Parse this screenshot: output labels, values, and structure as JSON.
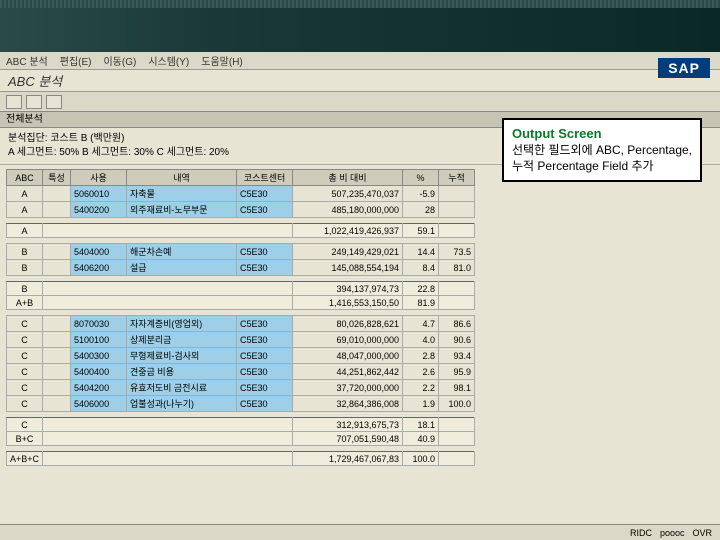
{
  "menu": {
    "items": [
      "ABC 분석",
      "편집(E)",
      "이동(G)",
      "시스템(Y)",
      "도움말(H)"
    ]
  },
  "title": "ABC 분석",
  "sub": "전체분석",
  "logo": "SAP",
  "params": {
    "line1": "분석집단: 코스트 B (백만원)",
    "line2": "A 세그먼트: 50%    B 세그먼트: 30%    C 세그먼트: 20%"
  },
  "headers": [
    "ABC",
    "특성",
    "사용",
    "내역",
    "코스트센터",
    "총 비 대비",
    "%",
    "누적"
  ],
  "rows": [
    {
      "abc": "A",
      "code": "5060010",
      "desc": "자축물",
      "cc": "C5E30",
      "v1": "507,235,470,037",
      "v2": "-5.9",
      "v3": ""
    },
    {
      "abc": "A",
      "code": "5400200",
      "desc": "외주재료비-노무부문",
      "cc": "C5E30",
      "v1": "485,180,000,000",
      "v2": "28",
      "v3": ""
    }
  ],
  "sumA": {
    "abc": "A",
    "v1": "1,022,419,426,937",
    "v2": "59.1"
  },
  "rowsB": [
    {
      "abc": "B",
      "code": "5404000",
      "desc": "해군차손예",
      "cc": "C5E30",
      "v1": "249,149,429,021",
      "v2": "14.4",
      "v3": "73.5"
    },
    {
      "abc": "B",
      "code": "5406200",
      "desc": "설급",
      "cc": "C5E30",
      "v1": "145,088,554,194",
      "v2": "8.4",
      "v3": "81.0"
    }
  ],
  "sumB": {
    "abc": "B",
    "v1": "394,137,974,73",
    "v2": "22.8"
  },
  "sumAB": {
    "abc": "A+B",
    "v1": "1,416,553,150,50",
    "v2": "81.9"
  },
  "rowsC": [
    {
      "abc": "C",
      "code": "8070030",
      "desc": "자자계증비(영업외)",
      "cc": "C5E30",
      "v1": "80,026,828,621",
      "v2": "4.7",
      "v3": "86.6"
    },
    {
      "abc": "C",
      "code": "5100100",
      "desc": "상제분리금",
      "cc": "C5E30",
      "v1": "69,010,000,000",
      "v2": "4.0",
      "v3": "90.6"
    },
    {
      "abc": "C",
      "code": "5400300",
      "desc": "무형제료비-검사외",
      "cc": "C5E30",
      "v1": "48,047,000,000",
      "v2": "2.8",
      "v3": "93.4"
    },
    {
      "abc": "C",
      "code": "5400400",
      "desc": "견중금 비용",
      "cc": "C5E30",
      "v1": "44,251,862,442",
      "v2": "2.6",
      "v3": "95.9"
    },
    {
      "abc": "C",
      "code": "5404200",
      "desc": "유효저도비 금전시료",
      "cc": "C5E30",
      "v1": "37,720,000,000",
      "v2": "2.2",
      "v3": "98.1"
    },
    {
      "abc": "C",
      "code": "5406000",
      "desc": "업불성과(나누기)",
      "cc": "C5E30",
      "v1": "32,864,386,008",
      "v2": "1.9",
      "v3": "100.0"
    }
  ],
  "sumC": {
    "abc": "C",
    "v1": "312,913,675,73",
    "v2": "18.1"
  },
  "sumBC": {
    "abc": "B+C",
    "v1": "707,051,590,48",
    "v2": "40.9"
  },
  "sumABC": {
    "abc": "A+B+C",
    "v1": "1,729,467,067,83",
    "v2": "100.0"
  },
  "callout": {
    "title": "Output Screen",
    "body": "선택한 필드외에 ABC, Percentage, 누적 Percentage Field 추가"
  },
  "status": {
    "left": "RIDC",
    "right": "poooc",
    "end": "OVR"
  }
}
